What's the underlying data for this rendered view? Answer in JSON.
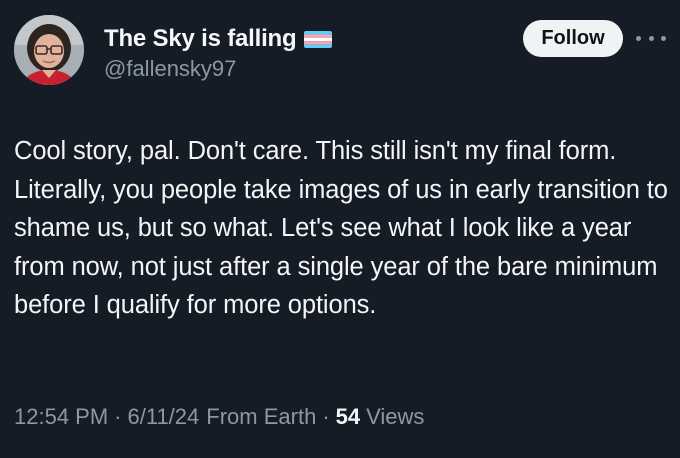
{
  "author": {
    "display_name": "The Sky is falling",
    "handle": "@fallensky97",
    "flag_icon": "transgender-flag-icon",
    "avatar_icon": "avatar-photo"
  },
  "actions": {
    "follow_label": "Follow",
    "more_icon": "more-horizontal-icon"
  },
  "tweet": {
    "text": "Cool story, pal. Don't care. This still isn't my final form. Literally, you people take images of us in early transition to shame us, but so what. Let's see what I look like a year from now, not just after a single year of the bare minimum before I qualify for more options."
  },
  "meta": {
    "time": "12:54 PM",
    "separator": "·",
    "date": "6/11/24",
    "source": "From Earth",
    "views_count": "54",
    "views_label": "Views"
  },
  "colors": {
    "background": "#151c26",
    "text_primary": "#f3f5f6",
    "text_secondary": "#8b98a5",
    "follow_button_bg": "#eff3f4",
    "flag_blue": "#5bcefa",
    "flag_pink": "#f5a9b8",
    "flag_white": "#ffffff"
  }
}
